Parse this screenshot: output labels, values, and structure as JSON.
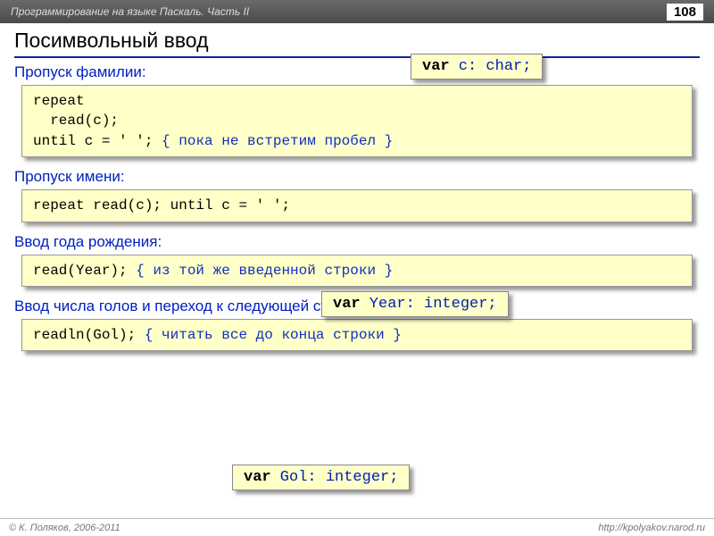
{
  "header": {
    "title": "Программирование на языке Паскаль. Часть II",
    "pagenum": "108"
  },
  "heading": "Посимвольный ввод",
  "sections": {
    "surname": {
      "label": "Пропуск фамилии:",
      "code_l1": "repeat",
      "code_l2": "  read(c);",
      "code_l3a": "until c = ' '; ",
      "code_l3b": "{ пока не встретим пробел }"
    },
    "name": {
      "label": "Пропуск имени:",
      "code": "repeat read(c); until c = ' ';"
    },
    "year": {
      "label": "Ввод года рождения:",
      "code_a": "read(Year); ",
      "code_b": "{ из той же введенной строки }"
    },
    "goals": {
      "label": "Ввод числа голов и переход к следующей строке:",
      "code_a": "readln(Gol); ",
      "code_b": "{ читать все до конца строки }"
    }
  },
  "tags": {
    "char": {
      "kw": "var",
      "rest": " c: char;"
    },
    "year": {
      "kw": "var",
      "rest": " Year: integer;"
    },
    "gol": {
      "kw": "var",
      "rest": " Gol: integer;"
    }
  },
  "footer": {
    "left": "© К. Поляков, 2006-2011",
    "right": "http://kpolyakov.narod.ru"
  }
}
